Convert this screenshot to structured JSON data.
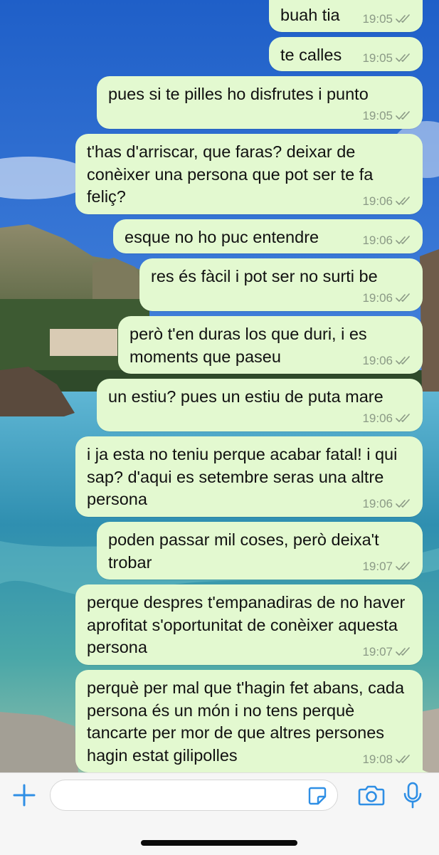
{
  "colors": {
    "bubble_out": "#e3f9d0",
    "meta_text": "#8b9a86",
    "accent_icon": "#2f8fe5",
    "footer_bg": "#f6f6f6"
  },
  "messages": [
    {
      "text": "buah tia",
      "time": "19:05",
      "status": "read"
    },
    {
      "text": "te calles",
      "time": "19:05",
      "status": "read"
    },
    {
      "text": "pues si te pilles ho disfrutes i punto",
      "time": "19:05",
      "status": "read"
    },
    {
      "text": "t'has d'arriscar, que faras? deixar de conèixer una persona que pot ser te fa feliç?",
      "time": "19:06",
      "status": "read"
    },
    {
      "text": "esque no ho puc entendre",
      "time": "19:06",
      "status": "read"
    },
    {
      "text": "res és fàcil i pot ser no surti be",
      "time": "19:06",
      "status": "read"
    },
    {
      "text": "però t'en duras los que duri, i es moments que paseu",
      "time": "19:06",
      "status": "read"
    },
    {
      "text": "un estiu? pues un estiu de puta mare",
      "time": "19:06",
      "status": "read"
    },
    {
      "text": "i ja esta no teniu perque acabar fatal! i qui sap? d'aqui es setembre seras una altre persona",
      "time": "19:06",
      "status": "read"
    },
    {
      "text": "poden passar mil coses, però deixa't trobar",
      "time": "19:07",
      "status": "read"
    },
    {
      "text": "perque despres t'empanadiras de no haver aprofitat s'oportunitat de conèixer aquesta persona",
      "time": "19:07",
      "status": "read"
    },
    {
      "text": "perquè per mal que t'hagin fet abans, cada persona és un món i no tens perquè tancarte per mor de que altres persones hagin estat gilipolles",
      "time": "19:08",
      "status": "read"
    }
  ],
  "composer": {
    "input_value": "",
    "icons": [
      "plus-icon",
      "sticker-icon",
      "camera-icon",
      "microphone-icon"
    ]
  }
}
